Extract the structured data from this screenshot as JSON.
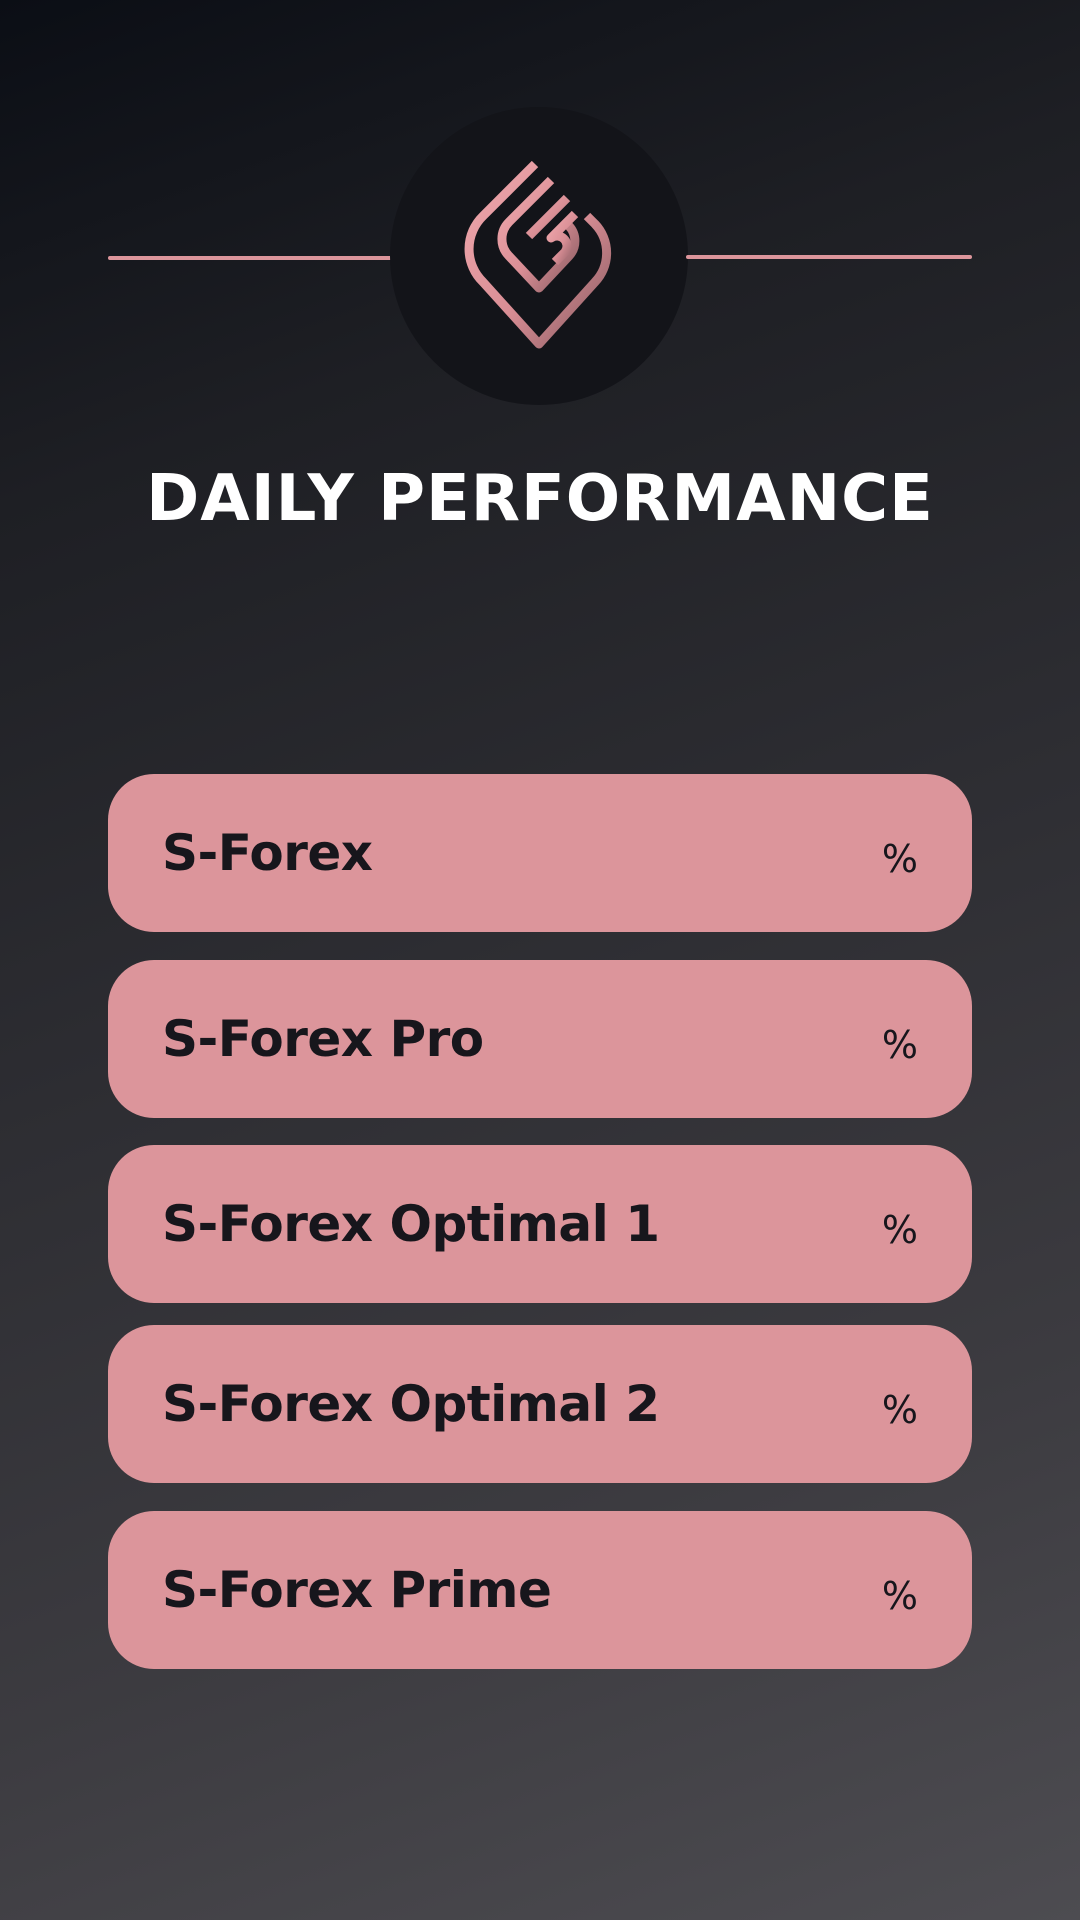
{
  "colors": {
    "accent": "#dc959b",
    "logo_dark": "#131419",
    "text_dark": "#17161c"
  },
  "header": {
    "logo_icon": "brand-logo-icon",
    "title": "DAILY PERFORMANCE"
  },
  "products": [
    {
      "name": "S-Forex",
      "value": "%"
    },
    {
      "name": "S-Forex Pro",
      "value": "%"
    },
    {
      "name": "S-Forex Optimal 1",
      "value": "%"
    },
    {
      "name": "S-Forex Optimal 2",
      "value": "%"
    },
    {
      "name": "S-Forex Prime",
      "value": "%"
    }
  ]
}
